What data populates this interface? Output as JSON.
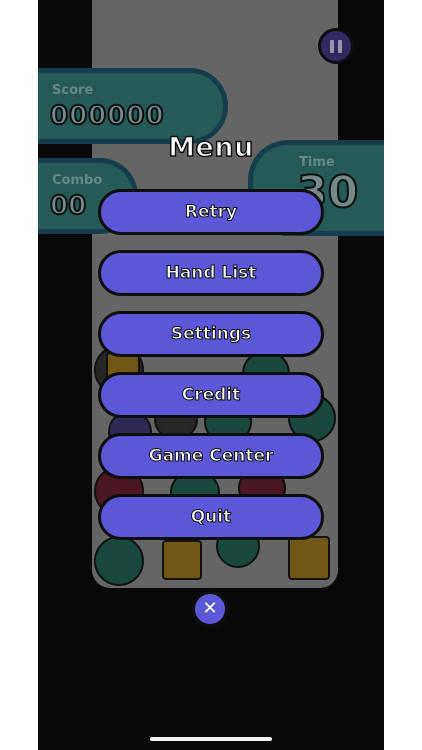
{
  "hud": {
    "score_label": "Score",
    "score_value": "000000",
    "combo_label": "Combo",
    "combo_value": "00",
    "time_label": "Time",
    "time_value": "30",
    "pause_icon": "pause-icon"
  },
  "menu": {
    "title": "Menu",
    "items": [
      {
        "label": "Retry"
      },
      {
        "label": "Hand List"
      },
      {
        "label": "Settings"
      },
      {
        "label": "Credit"
      },
      {
        "label": "Game Center"
      },
      {
        "label": "Quit"
      }
    ],
    "close_glyph": "✕",
    "close_icon": "close-icon"
  },
  "colors": {
    "button": "#5b57d6",
    "panel": "#2e6f6a",
    "background": "#0a0a0a"
  }
}
